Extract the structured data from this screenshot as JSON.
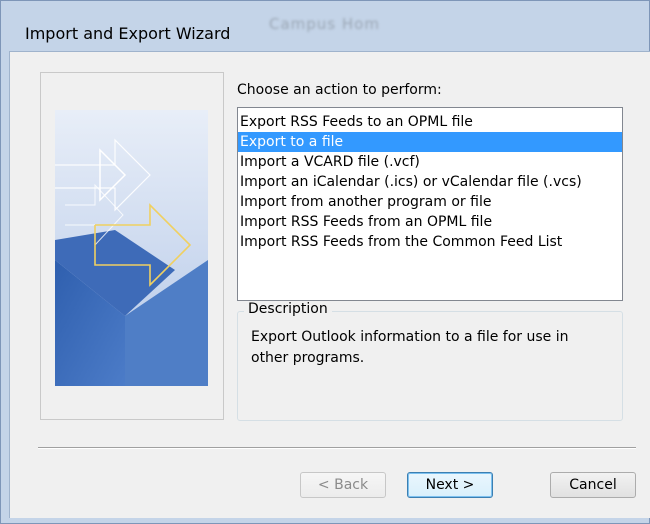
{
  "background_window": {
    "text": "Campus Hom"
  },
  "window": {
    "title": "Import and Export Wizard"
  },
  "prompt": "Choose an action to perform:",
  "actions": [
    {
      "label": "Export RSS Feeds to an OPML file",
      "selected": false
    },
    {
      "label": "Export to a file",
      "selected": true
    },
    {
      "label": "Import a VCARD file (.vcf)",
      "selected": false
    },
    {
      "label": "Import an iCalendar (.ics) or vCalendar file (.vcs)",
      "selected": false
    },
    {
      "label": "Import from another program or file",
      "selected": false
    },
    {
      "label": "Import RSS Feeds from an OPML file",
      "selected": false
    },
    {
      "label": "Import RSS Feeds from the Common Feed List",
      "selected": false
    }
  ],
  "description": {
    "legend": "Description",
    "text": "Export Outlook information to a file for use in other programs."
  },
  "buttons": {
    "back": "< Back",
    "next": "Next >",
    "cancel": "Cancel"
  },
  "colors": {
    "selection": "#3399ff",
    "frame": "#c4d4e8",
    "art_blue": "#4a74bd",
    "arrow_yellow": "#f0d060"
  },
  "icons": {
    "wizard_art": "arrows-illustration"
  }
}
